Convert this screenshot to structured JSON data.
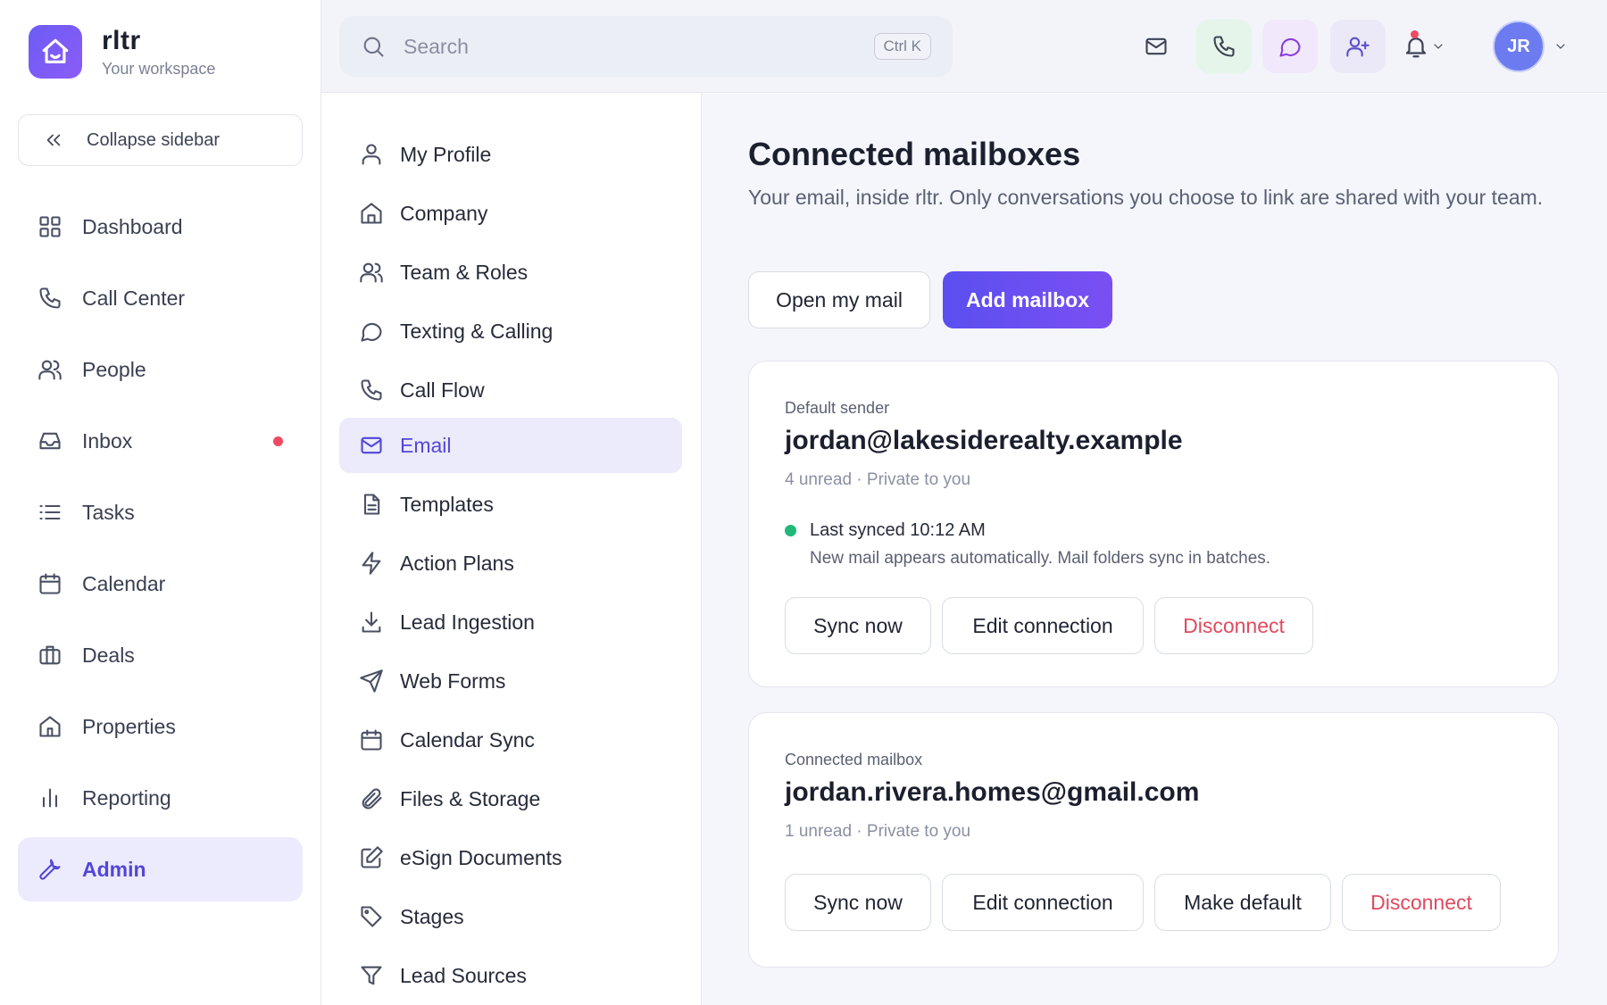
{
  "brand": {
    "name": "rltr",
    "subtitle": "Your workspace"
  },
  "sidebar": {
    "collapse_label": "Collapse sidebar",
    "items": [
      {
        "label": "Dashboard",
        "icon": "grid-icon"
      },
      {
        "label": "Call Center",
        "icon": "phone-icon"
      },
      {
        "label": "People",
        "icon": "users-icon"
      },
      {
        "label": "Inbox",
        "icon": "inbox-icon",
        "badge": true
      },
      {
        "label": "Tasks",
        "icon": "list-icon"
      },
      {
        "label": "Calendar",
        "icon": "calendar-icon"
      },
      {
        "label": "Deals",
        "icon": "briefcase-icon"
      },
      {
        "label": "Properties",
        "icon": "home-icon"
      },
      {
        "label": "Reporting",
        "icon": "bar-chart-icon"
      },
      {
        "label": "Admin",
        "icon": "wrench-icon",
        "active": true
      }
    ]
  },
  "topbar": {
    "search_placeholder": "Search",
    "shortcut": "Ctrl K",
    "avatar_initials": "JR"
  },
  "settings_menu": {
    "items": [
      {
        "label": "My Profile",
        "icon": "user-icon"
      },
      {
        "label": "Company",
        "icon": "building-icon"
      },
      {
        "label": "Team & Roles",
        "icon": "users-icon"
      },
      {
        "label": "Texting & Calling",
        "icon": "chat-icon"
      },
      {
        "label": "Call Flow",
        "icon": "phone-icon"
      },
      {
        "label": "Email",
        "icon": "mail-icon",
        "active": true
      },
      {
        "label": "Templates",
        "icon": "file-icon"
      },
      {
        "label": "Action Plans",
        "icon": "lightning-icon"
      },
      {
        "label": "Lead Ingestion",
        "icon": "download-icon"
      },
      {
        "label": "Web Forms",
        "icon": "send-icon"
      },
      {
        "label": "Calendar Sync",
        "icon": "calendar-icon"
      },
      {
        "label": "Files & Storage",
        "icon": "paperclip-icon"
      },
      {
        "label": "eSign Documents",
        "icon": "edit-icon"
      },
      {
        "label": "Stages",
        "icon": "tag-icon"
      },
      {
        "label": "Lead Sources",
        "icon": "filter-icon"
      }
    ]
  },
  "main": {
    "title": "Connected mailboxes",
    "description": "Your email, inside rltr. Only conversations you choose to link are shared with your team.",
    "open_mail_label": "Open my mail",
    "add_mailbox_label": "Add mailbox",
    "mailboxes": [
      {
        "label": "Default sender",
        "email": "jordan@lakesiderealty.example",
        "meta": "4 unread · Private to you",
        "sync_title": "Last synced 10:12 AM",
        "sync_note": "New mail appears automatically. Mail folders sync in batches.",
        "actions": [
          "Sync now",
          "Edit connection",
          "Disconnect"
        ]
      },
      {
        "label": "Connected mailbox",
        "email": "jordan.rivera.homes@gmail.com",
        "meta": "1 unread · Private to you",
        "actions": [
          "Sync now",
          "Edit connection",
          "Make default",
          "Disconnect"
        ]
      }
    ]
  },
  "colors": {
    "accent": "#5346d8",
    "danger": "#e04a5e",
    "success": "#1fb97a"
  }
}
